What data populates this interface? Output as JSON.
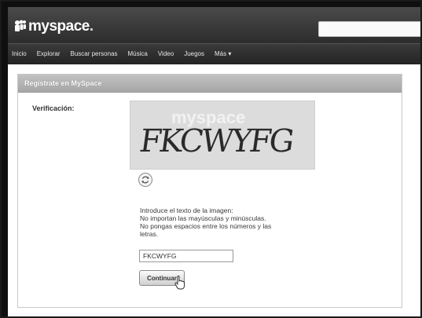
{
  "header": {
    "logo_text": "myspace",
    "logo_dot": "."
  },
  "nav": {
    "items": [
      "Inicio",
      "Explorar",
      "Buscar personas",
      "Música",
      "Video",
      "Juegos",
      "Más ▾"
    ]
  },
  "panel": {
    "title": "Regístrate en MySpace",
    "verification_label": "Verificación:",
    "captcha_text": "FKCWYFG",
    "captcha_watermark": "myspace",
    "instructions": [
      "Introduce el texto de la imagen:",
      "No importan las mayúsculas y minúsculas.",
      "No pongas espacios entre los números y las",
      "letras."
    ],
    "input_value": "FKCWYFG",
    "continue_label": "Continuar"
  },
  "icons": {
    "logo": "myspace-logo-icon",
    "refresh": "refresh-icon",
    "cursor": "hand-cursor-icon"
  }
}
